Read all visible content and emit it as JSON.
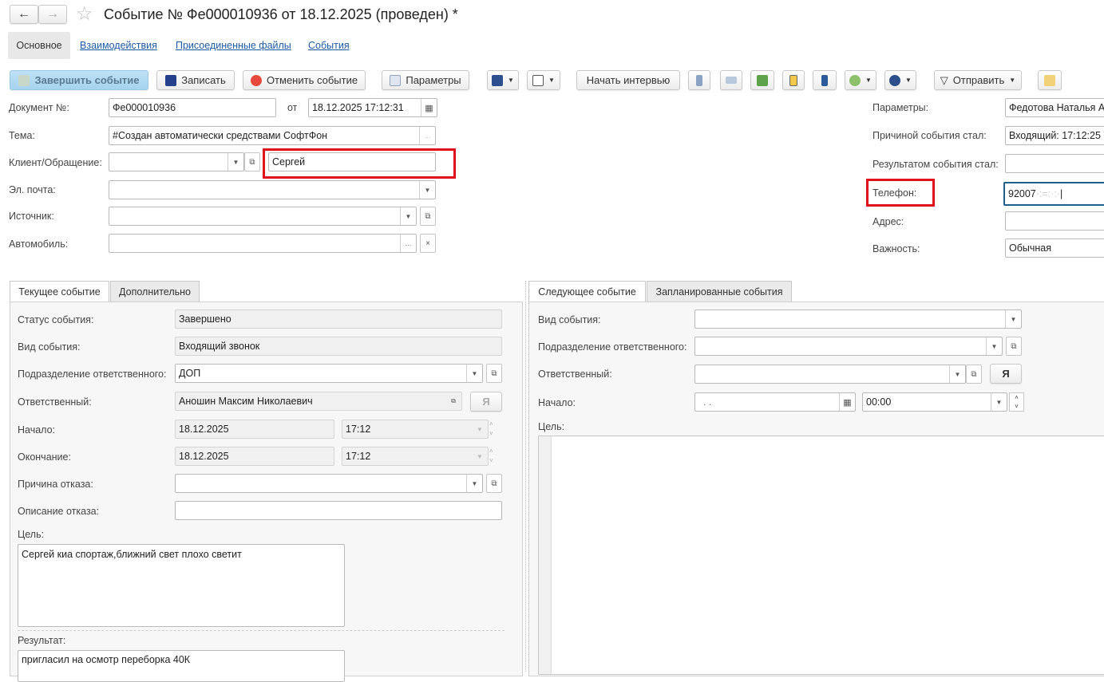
{
  "header": {
    "title": "Событие № Фе000010936 от 18.12.2025 (проведен) *",
    "back": "←",
    "forward": "→",
    "star": "☆"
  },
  "nav_tabs": [
    "Основное",
    "Взаимодействия",
    "Присоединенные файлы",
    "События"
  ],
  "toolbar": {
    "complete": "Завершить событие",
    "save": "Записать",
    "cancel": "Отменить событие",
    "params": "Параметры",
    "interview": "Начать интервью",
    "send": "Отправить"
  },
  "form": {
    "doc_label": "Документ №:",
    "doc_value": "Фе000010936",
    "from_label": "от",
    "date_value": "18.12.2025 17:12:31",
    "topic_label": "Тема:",
    "topic_value": "#Создан автоматически средствами СофтФон",
    "client_label": "Клиент/Обращение:",
    "client_value": "",
    "contact_value": "Сергей",
    "email_label": "Эл. почта:",
    "source_label": "Источник:",
    "car_label": "Автомобиль:"
  },
  "right": {
    "params_label": "Параметры:",
    "params_value": "Федотова Наталья А",
    "cause_label": "Причиной события стал:",
    "cause_value": "Входящий: 17:12:25",
    "result_label": "Результатом события стал:",
    "result_value": "",
    "phone_label": "Телефон:",
    "phone_value": "92007",
    "address_label": "Адрес:",
    "importance_label": "Важность:",
    "importance_value": "Обычная"
  },
  "current": {
    "tabs": [
      "Текущее событие",
      "Дополнительно"
    ],
    "status_label": "Статус события:",
    "status_value": "Завершено",
    "kind_label": "Вид события:",
    "kind_value": "Входящий звонок",
    "dept_label": "Подразделение ответственного:",
    "dept_value": "ДОП",
    "resp_label": "Ответственный:",
    "resp_value": "Аношин Максим Николаевич",
    "me": "Я",
    "start_label": "Начало:",
    "start_date": "18.12.2025",
    "start_time": "17:12",
    "end_label": "Окончание:",
    "end_date": "18.12.2025",
    "end_time": "17:12",
    "refuse_label": "Причина отказа:",
    "refuse_desc_label": "Описание отказа:",
    "goal_label": "Цель:",
    "goal_value": "Сергей киа спортаж,ближний свет плохо светит",
    "result_label": "Результат:",
    "result_value": "пригласил на осмотр переборка 40К"
  },
  "next": {
    "tabs": [
      "Следующее событие",
      "Запланированные события"
    ],
    "kind_label": "Вид события:",
    "dept_label": "Подразделение ответственного:",
    "resp_label": "Ответственный:",
    "me": "Я",
    "start_label": "Начало:",
    "start_date": " .  .",
    "start_time": "00:00",
    "goal_label": "Цель:"
  }
}
